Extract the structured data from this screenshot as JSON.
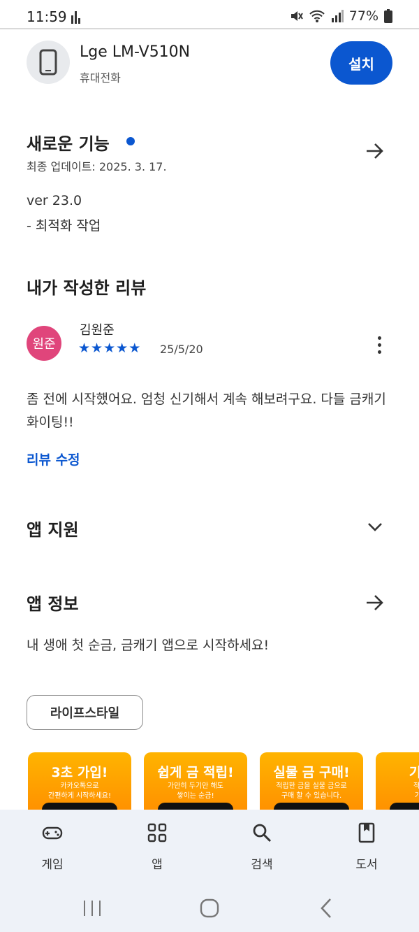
{
  "status_bar": {
    "time": "11:59",
    "battery": "77%"
  },
  "device": {
    "name": "Lge LM-V510N",
    "type": "휴대전화",
    "install_label": "설치"
  },
  "whats_new": {
    "title": "새로운 기능",
    "updated": "최종 업데이트: 2025. 3. 17.",
    "version": "ver 23.0",
    "note": "- 최적화 작업"
  },
  "my_review": {
    "title": "내가 작성한 리뷰",
    "avatar_text": "원준",
    "reviewer": "김원준",
    "rating": 5,
    "date": "25/5/20",
    "text": "좀 전에 시작했어요. 엄청 신기해서 계속 해보려구요. 다들 금캐기 화이팅!!",
    "edit_label": "리뷰 수정"
  },
  "app_support": {
    "title": "앱 지원"
  },
  "app_info": {
    "title": "앱 정보",
    "description": "내 생애 첫 순금, 금캐기 앱으로 시작하세요!",
    "category": "라이프스타일"
  },
  "screenshots": [
    {
      "title": "3초 가입!",
      "sub1": "카카오톡으로",
      "sub2": "간편하게 시작하세요!"
    },
    {
      "title": "쉽게 금 적립!",
      "sub1": "가만히 두기만 해도",
      "sub2": "쌓이는 순금!"
    },
    {
      "title": "실물 금 구매!",
      "sub1": "적립한 금을 실물 금으로",
      "sub2": "구매 할 수 있습니다."
    },
    {
      "title": "기프티",
      "sub1": "적립한 금",
      "sub2": "기프티콘"
    }
  ],
  "bottom_nav": [
    {
      "label": "게임",
      "icon": "gamepad-icon"
    },
    {
      "label": "앱",
      "icon": "apps-grid-icon"
    },
    {
      "label": "검색",
      "icon": "search-icon"
    },
    {
      "label": "도서",
      "icon": "book-icon"
    }
  ],
  "colors": {
    "accent": "#0b57d0",
    "avatar": "#e0457b",
    "screenshot_bg": "#ff9e00"
  }
}
